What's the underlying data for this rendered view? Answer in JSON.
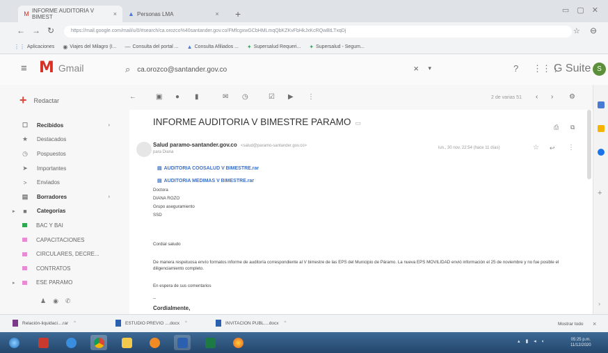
{
  "browser": {
    "tabs": [
      {
        "title": "INFORME AUDITORIA V BIMEST",
        "active": true
      },
      {
        "title": "Personas LMA",
        "active": false
      }
    ],
    "url": "https://mail.google.com/mail/u/0/#search/ca.orozco%40santander.gov.co/FMfcgxwGCbHMLmqQbKZKvFbHkJxKcRQwBtLTxqDj",
    "bookmarks": [
      "Aplicaciones",
      "Viajes del Milagro (I...",
      "Consulta del portal ...",
      "Consulta Afiliados ...",
      "Supersalud Requeri...",
      "Supersalud - Segum..."
    ]
  },
  "gmail": {
    "product": "Gmail",
    "search_query": "ca.orozco@santander.gov.co",
    "gsuite": "G Suite",
    "avatar_initial": "S"
  },
  "sidebar": {
    "compose": "Redactar",
    "items": [
      {
        "label": "Recibidos",
        "icon": "inbox-icon",
        "bold": true,
        "count": ""
      },
      {
        "label": "Destacados",
        "icon": "star-icon",
        "bold": false
      },
      {
        "label": "Pospuestos",
        "icon": "clock-icon",
        "bold": false
      },
      {
        "label": "Importantes",
        "icon": "important-icon",
        "bold": false
      },
      {
        "label": "Enviados",
        "icon": "send-icon",
        "bold": false
      },
      {
        "label": "Borradores",
        "icon": "draft-icon",
        "bold": true
      },
      {
        "label": "Categorías",
        "icon": "label-icon",
        "bold": true
      },
      {
        "label": "BAC Y BAI",
        "color": "#2fa84f"
      },
      {
        "label": "CAPACITACIONES",
        "color": "#e88bd4"
      },
      {
        "label": "CIRCULARES, DECRE...",
        "color": "#e88bd4"
      },
      {
        "label": "CONTRATOS",
        "color": "#e88bd4"
      },
      {
        "label": "ESE PARAMO",
        "color": "#e88bd4"
      },
      {
        "label": "",
        "color": "#2fa84f"
      }
    ]
  },
  "toolbar": {
    "pager": "2 de varias 51"
  },
  "message": {
    "subject": "INFORME AUDITORIA V BIMESTRE PARAMO",
    "sender_name": "Salud paramo-santander.gov.co",
    "sender_addr": "<salud@paramo-santander.gov.co>",
    "to": "para Diana",
    "date": "lun., 30 nov. 22:54 (hace 11 días)",
    "attachments": [
      "AUDITORIA COOSALUD V BIMESTRE.rar",
      "AUDITORIA MEDIMAS V BIMESTRE.rar"
    ],
    "greeting_lines": [
      "Doctora",
      "DIANA ROZO",
      "Grupo aseguramiento",
      "SSD"
    ],
    "salutation": "Cordial saludo",
    "body": "De manera respetuosa envío formatos informe de auditoría correspondiente al V bimestre de las EPS del Municipio de Páramo. La nueva EPS MOVILIDAD envió información el 25 de noviembre y no fue posible el diligenciamiento completo.",
    "waiting": "En espera de sus comentarios",
    "closing": "Cordialmente,"
  },
  "downloads": {
    "items": [
      "Relación-liquidaci....rar",
      "ESTUDIO PREVIO ....docx",
      "INVITACION PUBL....docx"
    ],
    "show_all": "Mostrar todo"
  },
  "taskbar": {
    "clock_time": "05:25 p.m.",
    "clock_date": "11/12/2020"
  }
}
